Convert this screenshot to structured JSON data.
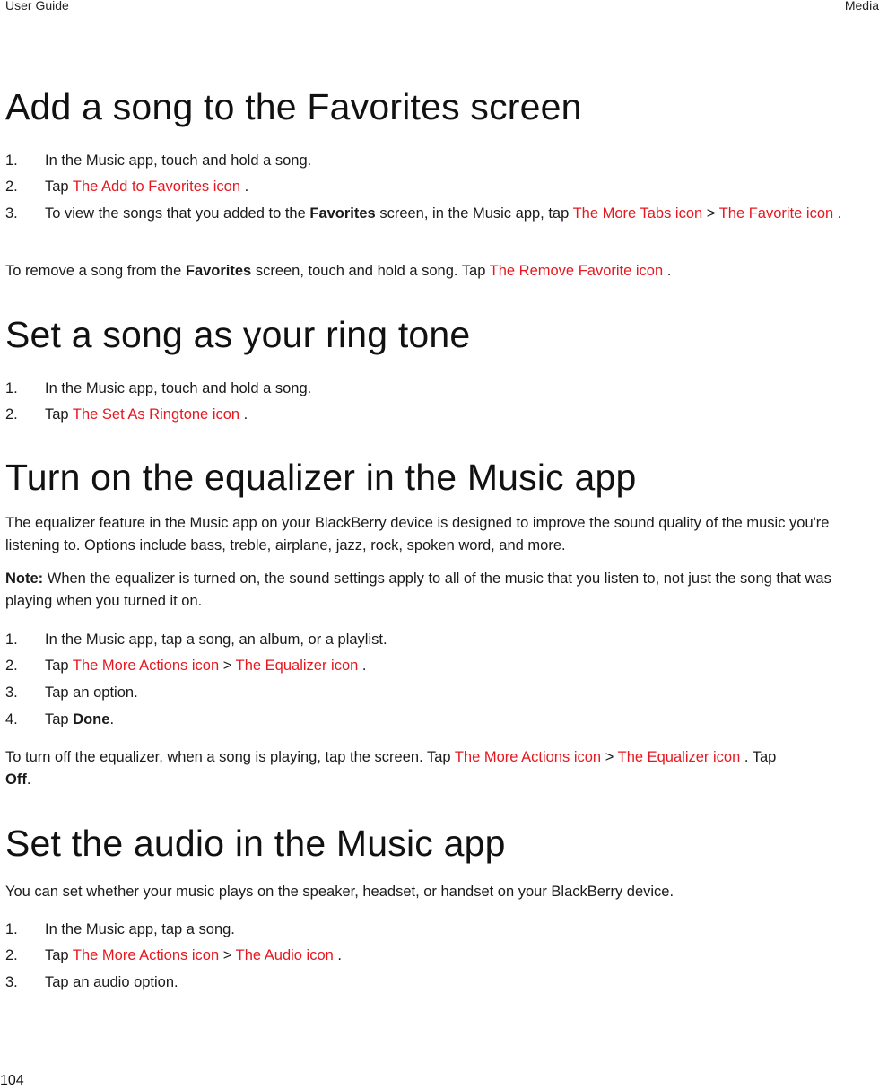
{
  "header": {
    "left": "User Guide",
    "right": "Media"
  },
  "footer": {
    "page_number": "104"
  },
  "sections": {
    "favorites": {
      "title": "Add a song to the Favorites screen",
      "steps": [
        {
          "num": "1.",
          "text": "In the Music app, touch and hold a song."
        },
        {
          "num": "2.",
          "pre": "Tap ",
          "link1": "The Add to Favorites icon",
          "post": " ."
        },
        {
          "num": "3.",
          "pre": "To view the songs that you added to the ",
          "bold": "Favorites",
          "mid": " screen, in the Music app, tap ",
          "link1": "The More Tabs icon",
          "sep": " > ",
          "link2": "The Favorite icon",
          "post": " ."
        }
      ],
      "note": {
        "pre": "To remove a song from the ",
        "bold": "Favorites",
        "mid": " screen, touch and hold a song. Tap ",
        "link": "The Remove Favorite icon",
        "post": " ."
      }
    },
    "ringtone": {
      "title": "Set a song as your ring tone",
      "steps": [
        {
          "num": "1.",
          "text": "In the Music app, touch and hold a song."
        },
        {
          "num": "2.",
          "pre": "Tap ",
          "link1": "The Set As Ringtone icon",
          "post": " ."
        }
      ]
    },
    "equalizer": {
      "title": "Turn on the equalizer in the Music app",
      "intro": "The equalizer feature in the Music app on your BlackBerry device is designed to improve the sound quality of the music you're listening to. Options include bass, treble, airplane, jazz, rock, spoken word, and more.",
      "note_label": "Note:",
      "note_text": " When the equalizer is turned on, the sound settings apply to all of the music that you listen to, not just the song that was playing when you turned it on.",
      "steps": [
        {
          "num": "1.",
          "text": "In the Music app, tap a song, an album, or a playlist."
        },
        {
          "num": "2.",
          "pre": "Tap ",
          "link1": "The More Actions icon",
          "sep": " > ",
          "link2": "The Equalizer icon",
          "post": " ."
        },
        {
          "num": "3.",
          "text": "Tap an option."
        },
        {
          "num": "4.",
          "pre": "Tap ",
          "bold": "Done",
          "post": "."
        }
      ],
      "off": {
        "pre": "To turn off the equalizer, when a song is playing, tap the screen. Tap ",
        "link1": "The More Actions icon",
        "sep": " > ",
        "link2": "The Equalizer icon",
        "mid": " . Tap ",
        "bold": "Off",
        "post": "."
      }
    },
    "audio": {
      "title": "Set the audio in the Music app",
      "intro": "You can set whether your music plays on the speaker, headset, or handset on your BlackBerry device.",
      "steps": [
        {
          "num": "1.",
          "text": "In the Music app, tap a song."
        },
        {
          "num": "2.",
          "pre": "Tap ",
          "link1": "The More Actions icon",
          "sep": " > ",
          "link2": "The Audio icon",
          "post": " ."
        },
        {
          "num": "3.",
          "text": "Tap an audio option."
        }
      ]
    }
  },
  "colors": {
    "link_red": "#e8171f",
    "text": "#1a1a1a"
  }
}
